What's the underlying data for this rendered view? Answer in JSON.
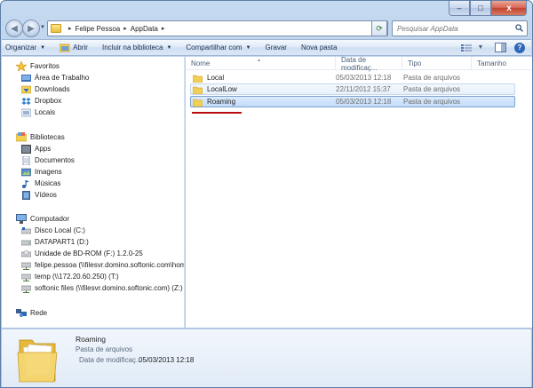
{
  "window": {
    "caption_min": "–",
    "caption_max": "□",
    "caption_close": "x"
  },
  "address": {
    "crumbs": [
      "Felipe Pessoa",
      "AppData"
    ],
    "separator": "▸"
  },
  "search": {
    "placeholder": "Pesquisar AppData"
  },
  "toolbar": {
    "organize": "Organizar",
    "open": "Abrir",
    "include_library": "Incluir na biblioteca",
    "share": "Compartilhar com",
    "burn": "Gravar",
    "new_folder": "Nova pasta"
  },
  "nav": {
    "favorites": {
      "title": "Favoritos",
      "items": [
        "Área de Trabalho",
        "Downloads",
        "Dropbox",
        "Locais"
      ]
    },
    "libraries": {
      "title": "Bibliotecas",
      "items": [
        "Apps",
        "Documentos",
        "Imagens",
        "Músicas",
        "Vídeos"
      ]
    },
    "computer": {
      "title": "Computador",
      "items": [
        "Disco Local (C:)",
        "DATAPART1 (D:)",
        "Unidade de BD-ROM (F:) 1.2.0-25",
        "felipe.pessoa (\\\\filesvr.domino.softonic.com\\home",
        "temp (\\\\172.20.60.250) (T:)",
        "softonic files (\\\\filesvr.domino.softonic.com) (Z:)"
      ]
    },
    "network": {
      "title": "Rede"
    }
  },
  "columns": {
    "name": "Nome",
    "date": "Data de modificaç...",
    "type": "Tipo",
    "size": "Tamanho"
  },
  "files": [
    {
      "name": "Local",
      "date": "05/03/2013 12:18",
      "type": "Pasta de arquivos"
    },
    {
      "name": "LocalLow",
      "date": "22/11/2012 15:37",
      "type": "Pasta de arquivos"
    },
    {
      "name": "Roaming",
      "date": "05/03/2013 12:18",
      "type": "Pasta de arquivos"
    }
  ],
  "details": {
    "name": "Roaming",
    "type": "Pasta de arquivos",
    "date_label": "Data de modificaç...",
    "date_value": "05/03/2013 12:18"
  },
  "colors": {
    "selection": "#c1dcfb",
    "highlight_underline": "#b80d11",
    "folder": "#f2cf55"
  }
}
